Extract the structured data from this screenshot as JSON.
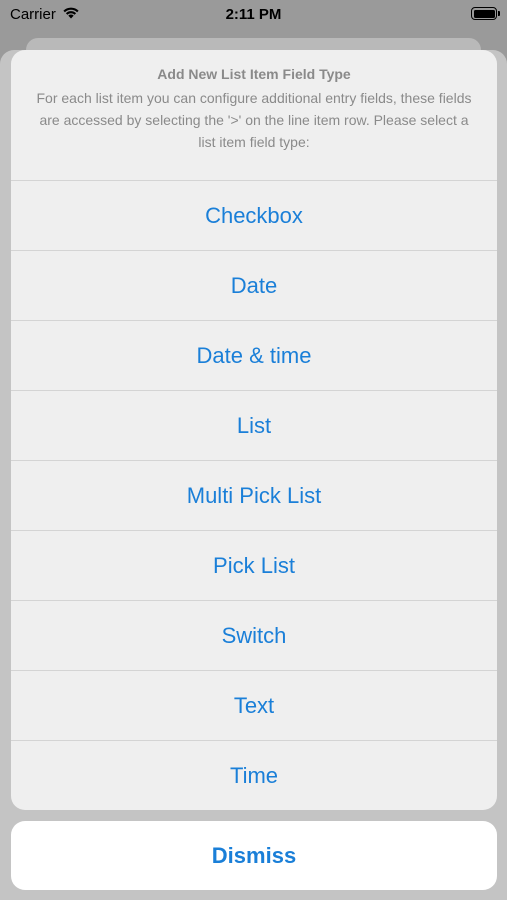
{
  "status_bar": {
    "carrier": "Carrier",
    "time": "2:11 PM",
    "wifi_icon": "wifi-icon",
    "battery_icon": "battery-icon",
    "battery_level": 1.0
  },
  "action_sheet": {
    "title": "Add New List Item Field Type",
    "message": "For each list item you can configure additional entry fields, these fields are accessed by selecting the '>' on the line item row. Please select a list item field type:",
    "options": [
      "Checkbox",
      "Date",
      "Date & time",
      "List",
      "Multi Pick List",
      "Pick List",
      "Switch",
      "Text",
      "Time"
    ],
    "dismiss_label": "Dismiss"
  },
  "colors": {
    "accent": "#1a7fd8",
    "sheet_background": "#efefef",
    "header_text": "#8a8a8a"
  }
}
